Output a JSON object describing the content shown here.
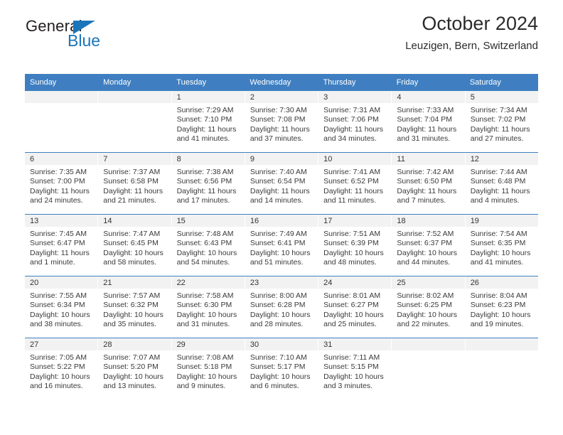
{
  "brand": {
    "line1": "General",
    "line2": "Blue",
    "accent_color": "#1b75bb",
    "text_color": "#231f20"
  },
  "header": {
    "title": "October 2024",
    "subtitle": "Leuzigen, Bern, Switzerland"
  },
  "theme": {
    "header_row_bg": "#3f7fc1",
    "day_band_bg": "#f2f2f2",
    "cell_bg": "#ffffff",
    "text": "#3a3a3a"
  },
  "weekdays": [
    "Sunday",
    "Monday",
    "Tuesday",
    "Wednesday",
    "Thursday",
    "Friday",
    "Saturday"
  ],
  "labels": {
    "sunrise_prefix": "Sunrise:",
    "sunset_prefix": "Sunset:",
    "daylight_prefix": "Daylight:"
  },
  "weeks": [
    [
      {
        "day": "",
        "empty": true
      },
      {
        "day": "",
        "empty": true
      },
      {
        "day": "1",
        "sunrise": "Sunrise: 7:29 AM",
        "sunset": "Sunset: 7:10 PM",
        "daylight1": "Daylight: 11 hours",
        "daylight2": "and 41 minutes."
      },
      {
        "day": "2",
        "sunrise": "Sunrise: 7:30 AM",
        "sunset": "Sunset: 7:08 PM",
        "daylight1": "Daylight: 11 hours",
        "daylight2": "and 37 minutes."
      },
      {
        "day": "3",
        "sunrise": "Sunrise: 7:31 AM",
        "sunset": "Sunset: 7:06 PM",
        "daylight1": "Daylight: 11 hours",
        "daylight2": "and 34 minutes."
      },
      {
        "day": "4",
        "sunrise": "Sunrise: 7:33 AM",
        "sunset": "Sunset: 7:04 PM",
        "daylight1": "Daylight: 11 hours",
        "daylight2": "and 31 minutes."
      },
      {
        "day": "5",
        "sunrise": "Sunrise: 7:34 AM",
        "sunset": "Sunset: 7:02 PM",
        "daylight1": "Daylight: 11 hours",
        "daylight2": "and 27 minutes."
      }
    ],
    [
      {
        "day": "6",
        "sunrise": "Sunrise: 7:35 AM",
        "sunset": "Sunset: 7:00 PM",
        "daylight1": "Daylight: 11 hours",
        "daylight2": "and 24 minutes."
      },
      {
        "day": "7",
        "sunrise": "Sunrise: 7:37 AM",
        "sunset": "Sunset: 6:58 PM",
        "daylight1": "Daylight: 11 hours",
        "daylight2": "and 21 minutes."
      },
      {
        "day": "8",
        "sunrise": "Sunrise: 7:38 AM",
        "sunset": "Sunset: 6:56 PM",
        "daylight1": "Daylight: 11 hours",
        "daylight2": "and 17 minutes."
      },
      {
        "day": "9",
        "sunrise": "Sunrise: 7:40 AM",
        "sunset": "Sunset: 6:54 PM",
        "daylight1": "Daylight: 11 hours",
        "daylight2": "and 14 minutes."
      },
      {
        "day": "10",
        "sunrise": "Sunrise: 7:41 AM",
        "sunset": "Sunset: 6:52 PM",
        "daylight1": "Daylight: 11 hours",
        "daylight2": "and 11 minutes."
      },
      {
        "day": "11",
        "sunrise": "Sunrise: 7:42 AM",
        "sunset": "Sunset: 6:50 PM",
        "daylight1": "Daylight: 11 hours",
        "daylight2": "and 7 minutes."
      },
      {
        "day": "12",
        "sunrise": "Sunrise: 7:44 AM",
        "sunset": "Sunset: 6:48 PM",
        "daylight1": "Daylight: 11 hours",
        "daylight2": "and 4 minutes."
      }
    ],
    [
      {
        "day": "13",
        "sunrise": "Sunrise: 7:45 AM",
        "sunset": "Sunset: 6:47 PM",
        "daylight1": "Daylight: 11 hours",
        "daylight2": "and 1 minute."
      },
      {
        "day": "14",
        "sunrise": "Sunrise: 7:47 AM",
        "sunset": "Sunset: 6:45 PM",
        "daylight1": "Daylight: 10 hours",
        "daylight2": "and 58 minutes."
      },
      {
        "day": "15",
        "sunrise": "Sunrise: 7:48 AM",
        "sunset": "Sunset: 6:43 PM",
        "daylight1": "Daylight: 10 hours",
        "daylight2": "and 54 minutes."
      },
      {
        "day": "16",
        "sunrise": "Sunrise: 7:49 AM",
        "sunset": "Sunset: 6:41 PM",
        "daylight1": "Daylight: 10 hours",
        "daylight2": "and 51 minutes."
      },
      {
        "day": "17",
        "sunrise": "Sunrise: 7:51 AM",
        "sunset": "Sunset: 6:39 PM",
        "daylight1": "Daylight: 10 hours",
        "daylight2": "and 48 minutes."
      },
      {
        "day": "18",
        "sunrise": "Sunrise: 7:52 AM",
        "sunset": "Sunset: 6:37 PM",
        "daylight1": "Daylight: 10 hours",
        "daylight2": "and 44 minutes."
      },
      {
        "day": "19",
        "sunrise": "Sunrise: 7:54 AM",
        "sunset": "Sunset: 6:35 PM",
        "daylight1": "Daylight: 10 hours",
        "daylight2": "and 41 minutes."
      }
    ],
    [
      {
        "day": "20",
        "sunrise": "Sunrise: 7:55 AM",
        "sunset": "Sunset: 6:34 PM",
        "daylight1": "Daylight: 10 hours",
        "daylight2": "and 38 minutes."
      },
      {
        "day": "21",
        "sunrise": "Sunrise: 7:57 AM",
        "sunset": "Sunset: 6:32 PM",
        "daylight1": "Daylight: 10 hours",
        "daylight2": "and 35 minutes."
      },
      {
        "day": "22",
        "sunrise": "Sunrise: 7:58 AM",
        "sunset": "Sunset: 6:30 PM",
        "daylight1": "Daylight: 10 hours",
        "daylight2": "and 31 minutes."
      },
      {
        "day": "23",
        "sunrise": "Sunrise: 8:00 AM",
        "sunset": "Sunset: 6:28 PM",
        "daylight1": "Daylight: 10 hours",
        "daylight2": "and 28 minutes."
      },
      {
        "day": "24",
        "sunrise": "Sunrise: 8:01 AM",
        "sunset": "Sunset: 6:27 PM",
        "daylight1": "Daylight: 10 hours",
        "daylight2": "and 25 minutes."
      },
      {
        "day": "25",
        "sunrise": "Sunrise: 8:02 AM",
        "sunset": "Sunset: 6:25 PM",
        "daylight1": "Daylight: 10 hours",
        "daylight2": "and 22 minutes."
      },
      {
        "day": "26",
        "sunrise": "Sunrise: 8:04 AM",
        "sunset": "Sunset: 6:23 PM",
        "daylight1": "Daylight: 10 hours",
        "daylight2": "and 19 minutes."
      }
    ],
    [
      {
        "day": "27",
        "sunrise": "Sunrise: 7:05 AM",
        "sunset": "Sunset: 5:22 PM",
        "daylight1": "Daylight: 10 hours",
        "daylight2": "and 16 minutes."
      },
      {
        "day": "28",
        "sunrise": "Sunrise: 7:07 AM",
        "sunset": "Sunset: 5:20 PM",
        "daylight1": "Daylight: 10 hours",
        "daylight2": "and 13 minutes."
      },
      {
        "day": "29",
        "sunrise": "Sunrise: 7:08 AM",
        "sunset": "Sunset: 5:18 PM",
        "daylight1": "Daylight: 10 hours",
        "daylight2": "and 9 minutes."
      },
      {
        "day": "30",
        "sunrise": "Sunrise: 7:10 AM",
        "sunset": "Sunset: 5:17 PM",
        "daylight1": "Daylight: 10 hours",
        "daylight2": "and 6 minutes."
      },
      {
        "day": "31",
        "sunrise": "Sunrise: 7:11 AM",
        "sunset": "Sunset: 5:15 PM",
        "daylight1": "Daylight: 10 hours",
        "daylight2": "and 3 minutes."
      },
      {
        "day": "",
        "empty": true
      },
      {
        "day": "",
        "empty": true
      }
    ]
  ]
}
